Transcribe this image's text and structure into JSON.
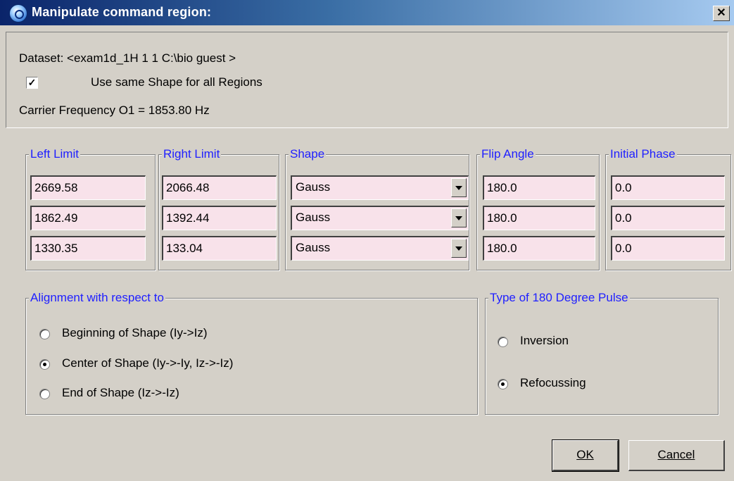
{
  "window": {
    "title": "Manipulate command region:",
    "close_label": "✕"
  },
  "header": {
    "dataset": "Dataset: <exam1d_1H  1  1  C:\\bio  guest >",
    "same_shape_label": "Use same Shape for all Regions",
    "same_shape_checked": true,
    "carrier": "Carrier Frequency O1 = 1853.80 Hz"
  },
  "columns": {
    "left_limit": "Left Limit",
    "right_limit": "Right Limit",
    "shape": "Shape",
    "flip_angle": "Flip Angle",
    "initial_phase": "Initial Phase"
  },
  "regions": [
    {
      "left": "2669.58",
      "right": "2066.48",
      "shape": "Gauss",
      "flip": "180.0",
      "phase": "0.0"
    },
    {
      "left": "1862.49",
      "right": "1392.44",
      "shape": "Gauss",
      "flip": "180.0",
      "phase": "0.0"
    },
    {
      "left": "1330.35",
      "right": "133.04",
      "shape": "Gauss",
      "flip": "180.0",
      "phase": "0.0"
    }
  ],
  "alignment": {
    "title": "Alignment with respect to",
    "options": [
      "Beginning of Shape (Iy->Iz)",
      "Center of Shape (Iy->-Iy, Iz->-Iz)",
      "End of Shape (Iz->-Iz)"
    ],
    "selected": 1
  },
  "pulse_type": {
    "title": "Type of 180 Degree Pulse",
    "options": [
      "Inversion",
      "Refocussing"
    ],
    "selected": 1
  },
  "buttons": {
    "ok": "OK",
    "cancel": "Cancel"
  },
  "colors": {
    "field_bg": "#f8e2ea",
    "group_title": "#2020ff",
    "titlebar": "#0a246a"
  }
}
